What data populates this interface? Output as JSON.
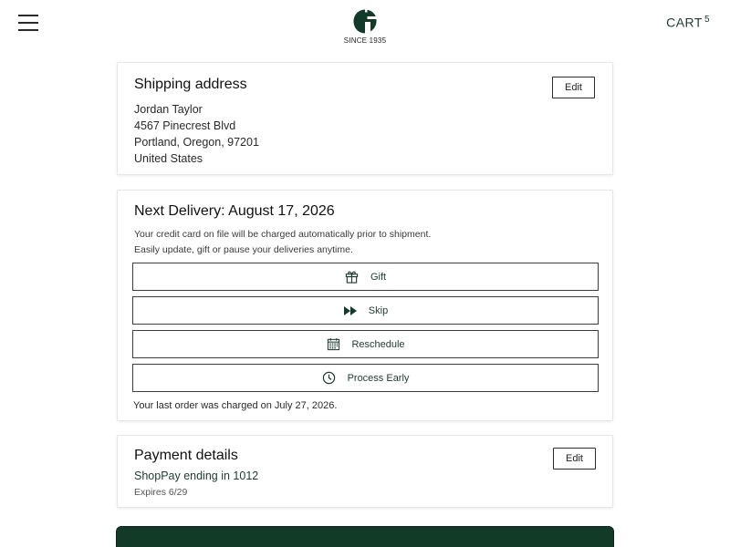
{
  "header": {
    "menu_icon": "hamburger-menu-icon",
    "logo_letter": "G",
    "logo_tagline": "SINCE 1935",
    "cart_label": "CART",
    "cart_count": "5"
  },
  "shipping": {
    "title": "Shipping address",
    "edit_label": "Edit",
    "name": "Jordan Taylor",
    "street": "4567 Pinecrest Blvd",
    "city_line": "Portland, Oregon, 97201",
    "country": "United States"
  },
  "delivery": {
    "title": "Next Delivery: August 17, 2026",
    "note_line1": "Your credit card on file will be charged automatically prior to shipment.",
    "note_line2": "Easily update, gift or pause your deliveries anytime.",
    "actions": [
      {
        "label": "Gift",
        "icon": "gift-icon"
      },
      {
        "label": "Skip",
        "icon": "fast-forward-icon"
      },
      {
        "label": "Reschedule",
        "icon": "calendar-icon"
      },
      {
        "label": "Process Early",
        "icon": "clock-icon"
      }
    ],
    "last_order": "Your last order was charged on July 27, 2026."
  },
  "payment": {
    "title": "Payment details",
    "edit_label": "Edit",
    "method": "ShopPay ending in 1012",
    "expires": "Expires 6/29"
  },
  "colors": {
    "brand_green": "#133a28",
    "accent_text": "#1f3a2f"
  }
}
